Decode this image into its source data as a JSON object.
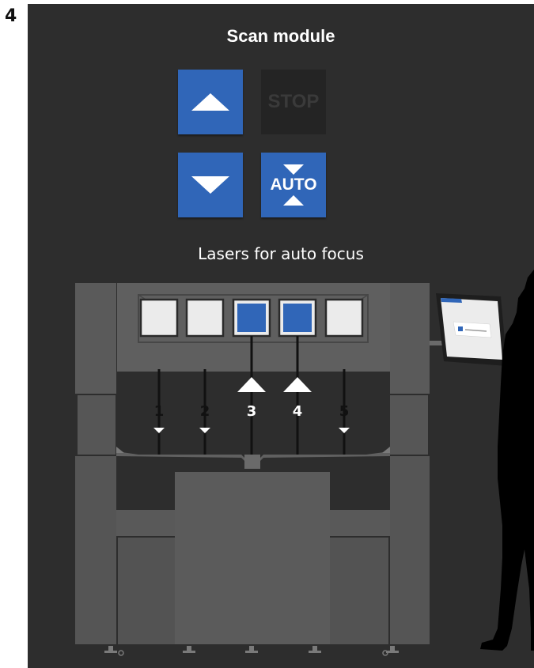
{
  "step_number": "4",
  "scan_module": {
    "title": "Scan module",
    "buttons": {
      "up_icon": "triangle-up-icon",
      "stop_label": "STOP",
      "down_icon": "triangle-down-icon",
      "auto_label": "AUTO"
    }
  },
  "lasers": {
    "title": "Lasers for auto focus",
    "items": [
      {
        "label": "1",
        "active": false
      },
      {
        "label": "2",
        "active": false
      },
      {
        "label": "3",
        "active": true
      },
      {
        "label": "4",
        "active": true
      },
      {
        "label": "5",
        "active": false
      }
    ]
  },
  "colors": {
    "accent_blue": "#3066b8",
    "background": "#2d2d2d",
    "machine_gray": "#5a5a5a"
  }
}
